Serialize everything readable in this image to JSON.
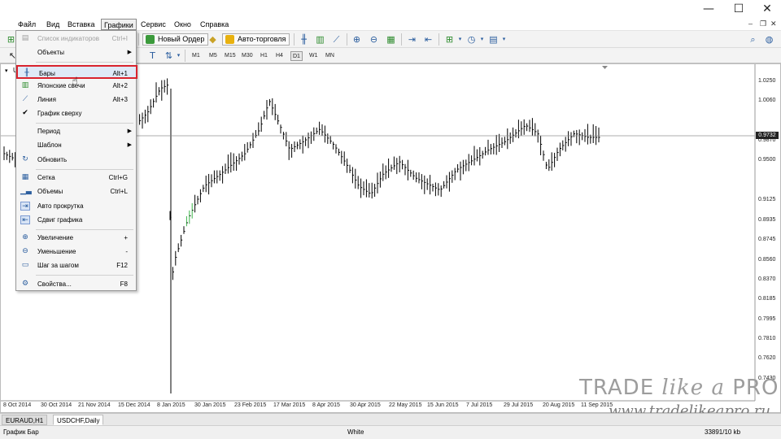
{
  "window": {
    "minimize": "—",
    "maximize": "☐",
    "close": "✕"
  },
  "menubar": {
    "items": [
      "Файл",
      "Вид",
      "Вставка",
      "Графики",
      "Сервис",
      "Окно",
      "Справка"
    ],
    "active": "Графики"
  },
  "toolbar": {
    "new_order_label": "Новый Ордер",
    "autotrading_label": "Авто-торговля"
  },
  "timeframes": {
    "items": [
      "M1",
      "M5",
      "M15",
      "M30",
      "H1",
      "H4",
      "D1",
      "W1",
      "MN"
    ],
    "active": "D1"
  },
  "dropdown": {
    "items": [
      {
        "label": "Список индикаторов",
        "shortcut": "Ctrl+I",
        "disabled": true
      },
      {
        "label": "Объекты",
        "submenu": true
      },
      {
        "label": "Бары",
        "shortcut": "Alt+1",
        "highlighted": true
      },
      {
        "label": "Японские свечи",
        "shortcut": "Alt+2"
      },
      {
        "label": "Линия",
        "shortcut": "Alt+3"
      },
      {
        "label": "График сверху",
        "checked": true
      },
      {
        "label": "Период",
        "submenu": true
      },
      {
        "label": "Шаблон",
        "submenu": true
      },
      {
        "label": "Обновить"
      },
      {
        "label": "Сетка",
        "shortcut": "Ctrl+G"
      },
      {
        "label": "Объемы",
        "shortcut": "Ctrl+L"
      },
      {
        "label": "Авто прокрутка"
      },
      {
        "label": "Сдвиг графика"
      },
      {
        "label": "Увеличение",
        "shortcut": "+"
      },
      {
        "label": "Уменьшение",
        "shortcut": "-"
      },
      {
        "label": "Шаг за шагом",
        "shortcut": "F12"
      },
      {
        "label": "Свойства...",
        "shortcut": "F8"
      }
    ]
  },
  "chart": {
    "symbol_marker": "U",
    "price_axis": [
      "1.0250",
      "1.0060",
      "0.9870",
      "0.9500",
      "0.9125",
      "0.8935",
      "0.8745",
      "0.8560",
      "0.8370",
      "0.8185",
      "0.7995",
      "0.7810",
      "0.7620",
      "0.7430"
    ],
    "current_price": "0.9732",
    "date_axis": [
      "8 Oct 2014",
      "30 Oct 2014",
      "21 Nov 2014",
      "15 Dec 2014",
      "8 Jan 2015",
      "30 Jan 2015",
      "23 Feb 2015",
      "17 Mar 2015",
      "8 Apr 2015",
      "30 Apr 2015",
      "22 May 2015",
      "15 Jun 2015",
      "7 Jul 2015",
      "29 Jul 2015",
      "20 Aug 2015",
      "11 Sep 2015"
    ]
  },
  "tabs": {
    "items": [
      "EURAUD,H1",
      "USDCHF,Daily"
    ],
    "active": "USDCHF,Daily"
  },
  "status": {
    "left": "График Бар",
    "middle": "White",
    "right": "33891/10 kb"
  },
  "watermark": {
    "title_part1": "TRADE ",
    "title_part2": "like a",
    "title_part3": " PRO",
    "url": "www.tradelikeapro.ru"
  }
}
